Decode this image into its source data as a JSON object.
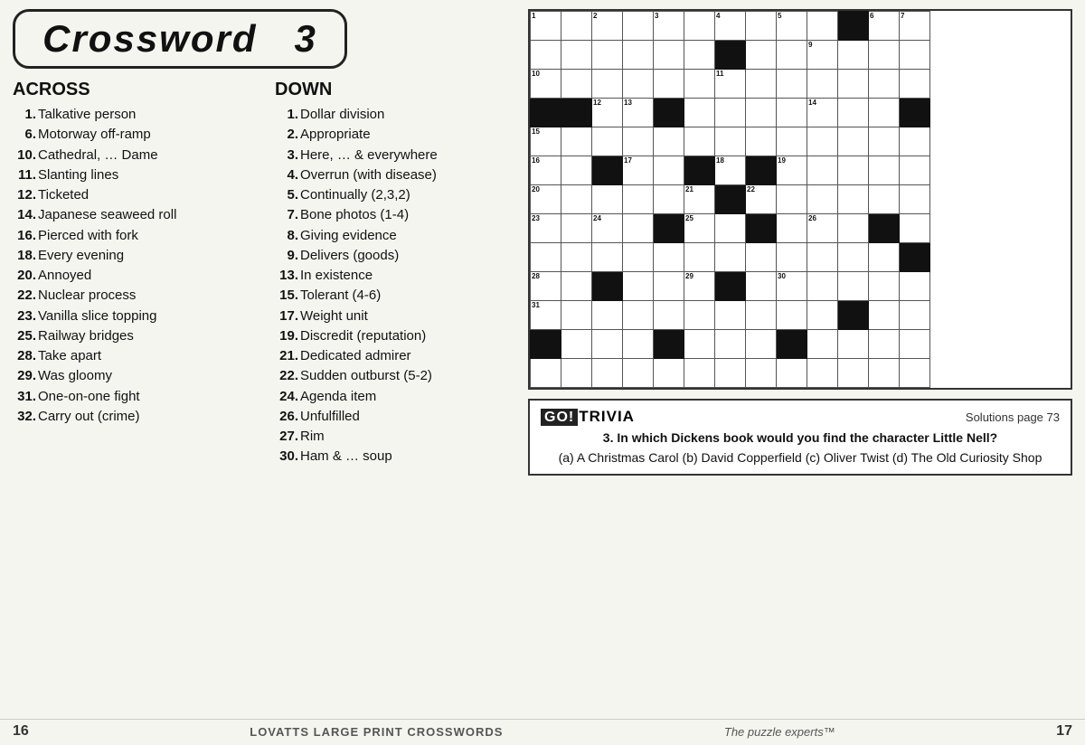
{
  "title": "Crossword",
  "title_number": "3",
  "across_heading": "ACROSS",
  "down_heading": "DOWN",
  "across_clues": [
    {
      "num": "1.",
      "text": "Talkative person"
    },
    {
      "num": "6.",
      "text": "Motorway off-ramp"
    },
    {
      "num": "10.",
      "text": "Cathedral, … Dame"
    },
    {
      "num": "11.",
      "text": "Slanting lines"
    },
    {
      "num": "12.",
      "text": "Ticketed"
    },
    {
      "num": "14.",
      "text": "Japanese seaweed roll"
    },
    {
      "num": "16.",
      "text": "Pierced with fork"
    },
    {
      "num": "18.",
      "text": "Every evening"
    },
    {
      "num": "20.",
      "text": "Annoyed"
    },
    {
      "num": "22.",
      "text": "Nuclear process"
    },
    {
      "num": "23.",
      "text": "Vanilla slice topping"
    },
    {
      "num": "25.",
      "text": "Railway bridges"
    },
    {
      "num": "28.",
      "text": "Take apart"
    },
    {
      "num": "29.",
      "text": "Was gloomy"
    },
    {
      "num": "31.",
      "text": "One-on-one fight"
    },
    {
      "num": "32.",
      "text": "Carry out (crime)"
    }
  ],
  "down_clues": [
    {
      "num": "1.",
      "text": "Dollar division"
    },
    {
      "num": "2.",
      "text": "Appropriate"
    },
    {
      "num": "3.",
      "text": "Here, … & everywhere"
    },
    {
      "num": "4.",
      "text": "Overrun (with disease)"
    },
    {
      "num": "5.",
      "text": "Continually (2,3,2)"
    },
    {
      "num": "7.",
      "text": "Bone photos (1-4)"
    },
    {
      "num": "8.",
      "text": "Giving evidence"
    },
    {
      "num": "9.",
      "text": "Delivers (goods)"
    },
    {
      "num": "13.",
      "text": "In existence"
    },
    {
      "num": "15.",
      "text": "Tolerant (4-6)"
    },
    {
      "num": "17.",
      "text": "Weight unit"
    },
    {
      "num": "19.",
      "text": "Discredit (reputation)"
    },
    {
      "num": "21.",
      "text": "Dedicated admirer"
    },
    {
      "num": "22.",
      "text": "Sudden outburst (5-2)"
    },
    {
      "num": "24.",
      "text": "Agenda item"
    },
    {
      "num": "26.",
      "text": "Unfulfilled"
    },
    {
      "num": "27.",
      "text": "Rim"
    },
    {
      "num": "30.",
      "text": "Ham & … soup"
    }
  ],
  "grid": {
    "rows": 13,
    "cols": 13
  },
  "trivia": {
    "logo_go": "GO!",
    "logo_trivia": "TRIVIA",
    "solutions": "Solutions page 73",
    "question": "3. In which Dickens book would you find the character Little Nell?",
    "answers": "(a) A Christmas Carol (b) David Copperfield (c) Oliver Twist (d) The Old Curiosity Shop"
  },
  "footer": {
    "page_left": "16",
    "publisher": "LOVATTS",
    "publication": "LARGE PRINT CROSSWORDS",
    "tagline": "The puzzle experts™",
    "page_right": "17"
  }
}
